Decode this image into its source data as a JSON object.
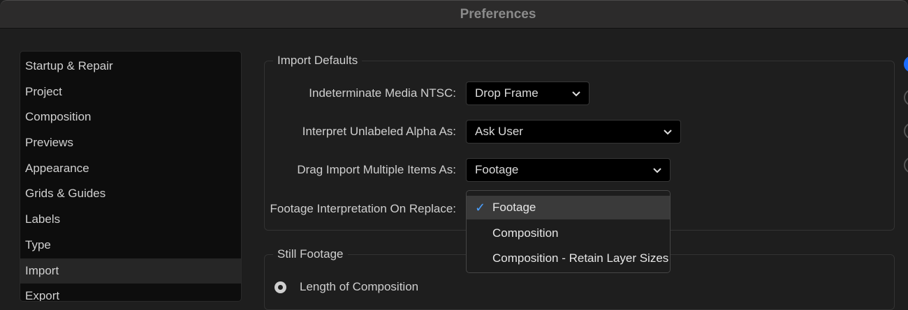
{
  "window": {
    "title": "Preferences"
  },
  "sidebar": {
    "items": [
      {
        "label": "Startup & Repair"
      },
      {
        "label": "Project"
      },
      {
        "label": "Composition"
      },
      {
        "label": "Previews"
      },
      {
        "label": "Appearance"
      },
      {
        "label": "Grids & Guides"
      },
      {
        "label": "Labels"
      },
      {
        "label": "Type"
      },
      {
        "label": "Import",
        "selected": true
      },
      {
        "label": "Export"
      }
    ]
  },
  "import_defaults": {
    "title": "Import Defaults",
    "ntsc": {
      "label": "Indeterminate Media NTSC:",
      "value": "Drop Frame"
    },
    "alpha": {
      "label": "Interpret Unlabeled Alpha As:",
      "value": "Ask User"
    },
    "drag": {
      "label": "Drag Import Multiple Items As:",
      "value": "Footage"
    },
    "replace": {
      "label": "Footage Interpretation On Replace:"
    }
  },
  "dropdown_menu": {
    "options": [
      {
        "label": "Footage",
        "checked": true
      },
      {
        "label": "Composition"
      },
      {
        "label": "Composition - Retain Layer Sizes"
      }
    ]
  },
  "still_footage": {
    "title": "Still Footage",
    "radio_length": "Length of Composition"
  },
  "colors": {
    "accent": "#4a9fff",
    "selected_radio": "#1a6cff"
  }
}
